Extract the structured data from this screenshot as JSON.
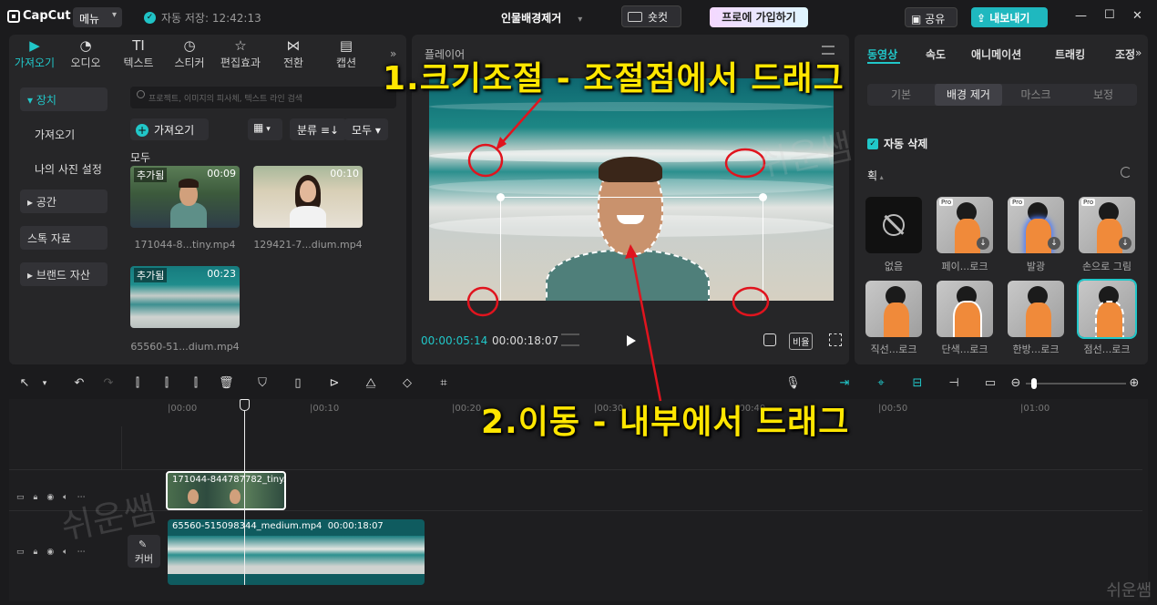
{
  "app": {
    "logo_text": "CapCut",
    "menu_label": "메뉴",
    "autosave_text": "자동 저장: 12:42:13",
    "project_title": "인물배경제거",
    "shortcut_label": "숏컷",
    "pro_label": "프로에 가입하기",
    "share_label": "공유",
    "export_label": "내보내기"
  },
  "media_tabs": [
    {
      "label": "가져오기",
      "icon": "import-icon"
    },
    {
      "label": "오디오",
      "icon": "audio-icon"
    },
    {
      "label": "텍스트",
      "icon": "text-icon"
    },
    {
      "label": "스티커",
      "icon": "sticker-icon"
    },
    {
      "label": "편집효과",
      "icon": "effects-icon"
    },
    {
      "label": "전환",
      "icon": "transition-icon"
    },
    {
      "label": "캡션",
      "icon": "caption-icon"
    }
  ],
  "sidebar": {
    "items": [
      {
        "label": "장치"
      },
      {
        "label": "가져오기"
      },
      {
        "label": "나의 사진 설정"
      },
      {
        "label": "공간"
      },
      {
        "label": "스톡 자료"
      },
      {
        "label": "브랜드 자산"
      }
    ]
  },
  "media": {
    "search_placeholder": "프로젝트, 이미지의 피사체, 텍스트 라인 검색",
    "import_label": "가져오기",
    "sort_label": "분류",
    "filter_label": "모두",
    "all_label": "모두",
    "items": [
      {
        "tag": "추가됨",
        "duration": "00:09",
        "name": "171044-8...tiny.mp4"
      },
      {
        "tag": "",
        "duration": "00:10",
        "name": "129421-7...dium.mp4"
      },
      {
        "tag": "추가됨",
        "duration": "00:23",
        "name": "65560-51...dium.mp4"
      }
    ]
  },
  "player": {
    "title": "플레이어",
    "current_time": "00:00:05:14",
    "total_time": "00:00:18:07",
    "ratio_label": "비율"
  },
  "props": {
    "tabs": [
      "동영상",
      "속도",
      "애니메이션",
      "트래킹",
      "조정"
    ],
    "subtabs": [
      "기본",
      "배경 제거",
      "마스크",
      "보정"
    ],
    "auto_delete_label": "자동 삭제",
    "stroke_label": "획",
    "effects": [
      {
        "label": "없음"
      },
      {
        "label": "페이...로크",
        "pro": "Pro"
      },
      {
        "label": "발광",
        "pro": "Pro"
      },
      {
        "label": "손으로 그림",
        "pro": "Pro"
      },
      {
        "label": "직선...로크"
      },
      {
        "label": "단색...로크"
      },
      {
        "label": "한방...로크"
      },
      {
        "label": "점선...로크"
      }
    ]
  },
  "timeline": {
    "ticks": [
      "|00:00",
      "|00:10",
      "|00:20",
      "|00:30",
      "|00:40",
      "|00:50",
      "|01:00"
    ],
    "clip1_label": "171044-844787782_tiny.",
    "clip2_name": "65560-515098344_medium.mp4",
    "clip2_duration": "00:00:18:07",
    "cover_label": "커버"
  },
  "annotations": {
    "resize": "1.크기조절 - 조절점에서 드래그",
    "move": "2.이동 - 내부에서 드래그",
    "watermark": "쉬운쌤"
  },
  "colors": {
    "accent": "#21c7c9",
    "annotation": "#ffe600",
    "annotation_marks": "#e0141e"
  }
}
